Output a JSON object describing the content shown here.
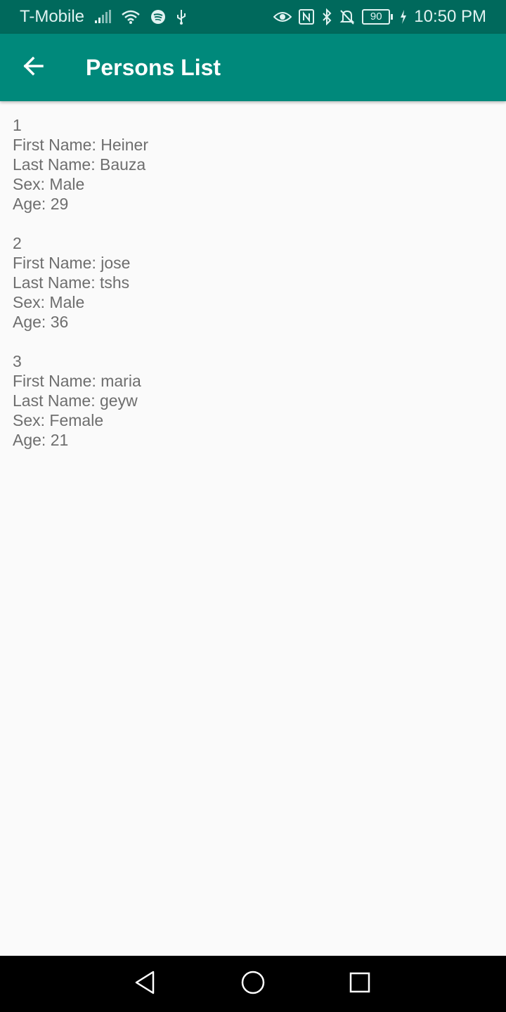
{
  "status_bar": {
    "carrier": "T-Mobile",
    "battery_level": "90",
    "time": "10:50 PM",
    "icons_left": [
      "signal-icon",
      "wifi-icon",
      "spotify-icon",
      "usb-icon"
    ],
    "icons_right": [
      "eye-icon",
      "nfc-icon",
      "bluetooth-icon",
      "notifications-off-icon",
      "battery-icon",
      "charging-icon"
    ]
  },
  "app_bar": {
    "title": "Persons List",
    "back_icon": "arrow-back-icon"
  },
  "persons": [
    {
      "index": "1",
      "first_name": "First Name: Heiner",
      "last_name": "Last Name: Bauza",
      "sex": "Sex: Male",
      "age": "Age: 29"
    },
    {
      "index": "2",
      "first_name": "First Name: jose",
      "last_name": "Last Name: tshs",
      "sex": "Sex: Male",
      "age": "Age: 36"
    },
    {
      "index": "3",
      "first_name": "First Name: maria",
      "last_name": "Last Name: geyw",
      "sex": "Sex: Female",
      "age": "Age: 21"
    }
  ],
  "nav_bar": {
    "icons": [
      "back-triangle-icon",
      "home-circle-icon",
      "recents-square-icon"
    ]
  },
  "colors": {
    "status_bar": "#00695c",
    "app_bar": "#00897b",
    "background": "#fafafa",
    "text": "#6e6e6e"
  }
}
